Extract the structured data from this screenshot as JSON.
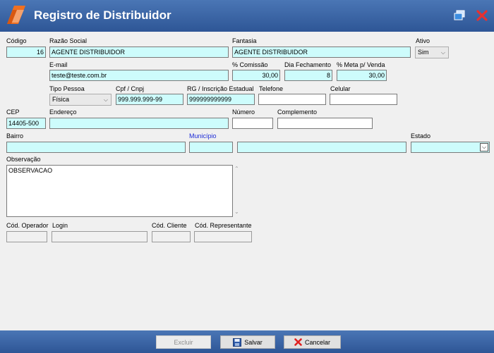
{
  "window": {
    "title": "Registro de Distribuidor"
  },
  "labels": {
    "codigo": "Código",
    "razao": "Razão Social",
    "fantasia": "Fantasia",
    "ativo": "Ativo",
    "email": "E-mail",
    "comissao": "% Comissão",
    "fechamento": "Dia Fechamento",
    "meta": "% Meta p/ Venda",
    "tipo": "Tipo Pessoa",
    "cpf": "Cpf / Cnpj",
    "rg": "RG / Inscrição Estadual",
    "telefone": "Telefone",
    "celular": "Celular",
    "cep": "CEP",
    "endereco": "Endereço",
    "numero": "Número",
    "complemento": "Complemento",
    "bairro": "Bairro",
    "municipio": "Município",
    "estado": "Estado",
    "observacao": "Observação",
    "cod_operador": "Cód. Operador",
    "login": "Login",
    "cod_cliente": "Cód. Cliente",
    "cod_representante": "Cód. Representante"
  },
  "values": {
    "codigo": "16",
    "razao": "AGENTE DISTRIBUIDOR",
    "fantasia": "AGENTE DISTRIBUIDOR",
    "ativo": "Sim",
    "email": "teste@teste.com.br",
    "comissao": "30,00",
    "fechamento": "8",
    "meta": "30,00",
    "tipo": "Física",
    "cpf": "999.999.999-99",
    "rg": "999999999999",
    "telefone": "",
    "celular": "",
    "cep": "14405-500",
    "endereco": "",
    "numero": "",
    "complemento": "",
    "bairro": "",
    "municipio_cod": "",
    "municipio": "",
    "estado": "",
    "observacao": "OBSERVACAO",
    "cod_operador": "",
    "login": "",
    "cod_cliente": "",
    "cod_representante": ""
  },
  "buttons": {
    "excluir": "Excluir",
    "salvar": "Salvar",
    "cancelar": "Cancelar"
  },
  "colors": {
    "field_bg": "#cdfcfc",
    "titlebar": "#3b64a6",
    "link": "#1c2bd6"
  }
}
